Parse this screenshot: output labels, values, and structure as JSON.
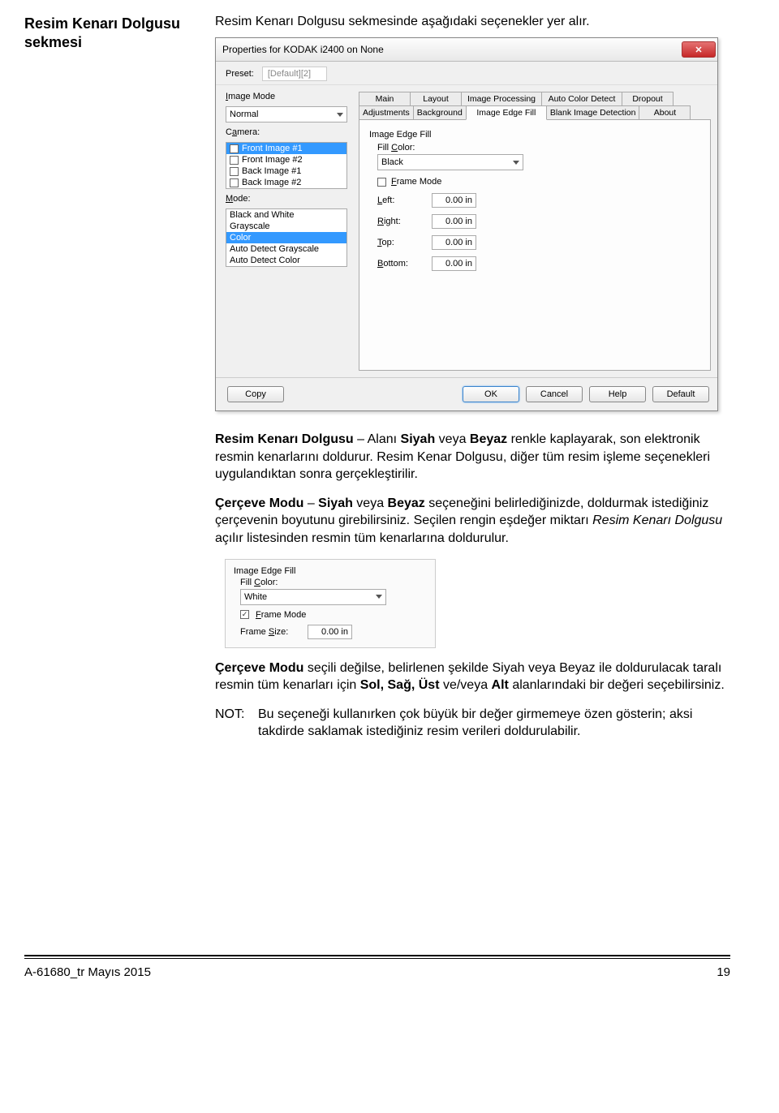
{
  "sidebar": {
    "title": "Resim Kenarı Dolgusu sekmesi"
  },
  "lead": "Resim Kenarı Dolgusu sekmesinde aşağıdaki seçenekler yer alır.",
  "dialog": {
    "title": "Properties for KODAK i2400 on None",
    "preset_label": "Preset:",
    "preset_value": "[Default][2]",
    "left": {
      "image_mode_label": "Image Mode",
      "image_mode_value": "Normal",
      "camera_label": "Camera:",
      "camera_items": [
        {
          "label": "Front Image #1",
          "checked": true,
          "selected": true
        },
        {
          "label": "Front Image #2",
          "checked": false,
          "selected": false
        },
        {
          "label": "Back Image #1",
          "checked": false,
          "selected": false
        },
        {
          "label": "Back Image #2",
          "checked": false,
          "selected": false
        }
      ],
      "mode_label": "Mode:",
      "mode_items": [
        {
          "label": "Black and White",
          "selected": false
        },
        {
          "label": "Grayscale",
          "selected": false
        },
        {
          "label": "Color",
          "selected": true
        },
        {
          "label": "Auto Detect Grayscale",
          "selected": false
        },
        {
          "label": "Auto Detect Color",
          "selected": false
        }
      ]
    },
    "tabs_row1": [
      "Main",
      "Layout",
      "Image Processing",
      "Auto Color Detect",
      "Dropout"
    ],
    "tabs_row2": [
      "Adjustments",
      "Background",
      "Image Edge Fill",
      "Blank Image Detection",
      "About"
    ],
    "active_tab": "Image Edge Fill",
    "panel": {
      "group": "Image Edge Fill",
      "fill_color_label": "Fill Color:",
      "fill_color_value": "Black",
      "frame_mode_label": "Frame Mode",
      "fields": [
        {
          "label": "Left:",
          "value": "0.00 in"
        },
        {
          "label": "Right:",
          "value": "0.00 in"
        },
        {
          "label": "Top:",
          "value": "0.00 in"
        },
        {
          "label": "Bottom:",
          "value": "0.00 in"
        }
      ]
    },
    "buttons": {
      "copy": "Copy",
      "ok": "OK",
      "cancel": "Cancel",
      "help": "Help",
      "default": "Default"
    }
  },
  "para1_a": "Resim Kenarı Dolgusu",
  "para1_b": " – Alanı ",
  "para1_c": "Siyah",
  "para1_d": " veya ",
  "para1_e": "Beyaz",
  "para1_f": " renkle kaplayarak, son elektronik resmin kenarlarını doldurur. Resim Kenar Dolgusu, diğer tüm resim işleme seçenekleri uygulandıktan sonra gerçekleştirilir.",
  "para2_a": "Çerçeve Modu",
  "para2_b": " – ",
  "para2_c": "Siyah",
  "para2_d": " veya ",
  "para2_e": "Beyaz",
  "para2_f": " seçeneğini belirlediğinizde, doldurmak istediğiniz çerçevenin boyutunu girebilirsiniz. Seçilen rengin eşdeğer miktarı ",
  "para2_g": "Resim Kenarı Dolgusu",
  "para2_h": " açılır listesinden resmin tüm kenarlarına doldurulur.",
  "mini": {
    "group": "Image Edge Fill",
    "fill_color_label": "Fill Color:",
    "fill_color_value": "White",
    "frame_mode_label": "Frame Mode",
    "frame_size_label": "Frame Size:",
    "frame_size_value": "0.00 in"
  },
  "para3_a": "Çerçeve Modu",
  "para3_b": " seçili değilse, belirlenen şekilde Siyah veya Beyaz ile doldurulacak taralı resmin tüm kenarları için ",
  "para3_c": "Sol, Sağ, Üst",
  "para3_d": " ve/veya ",
  "para3_e": "Alt",
  "para3_f": " alanlarındaki bir değeri seçebilirsiniz.",
  "note_label": "NOT:",
  "note_body": "Bu seçeneği kullanırken çok büyük bir değer girmemeye özen gösterin; aksi takdirde saklamak istediğiniz resim verileri doldurulabilir.",
  "footer": {
    "left": "A-61680_tr  Mayıs 2015",
    "right": "19"
  }
}
